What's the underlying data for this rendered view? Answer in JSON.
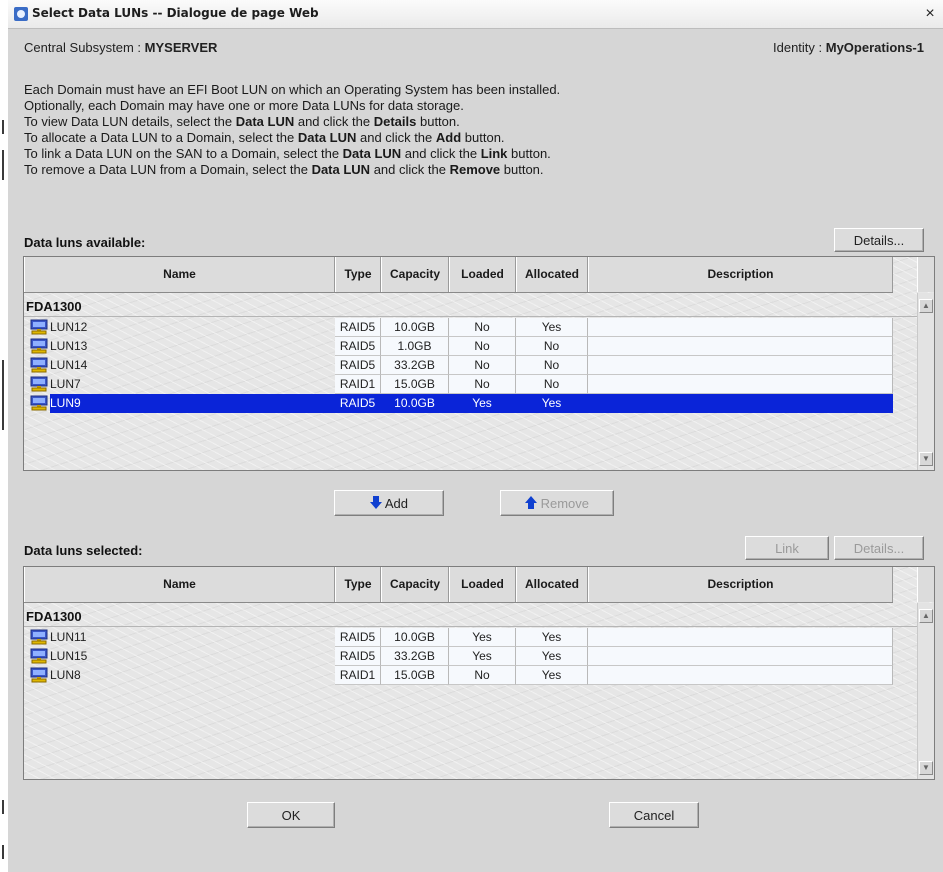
{
  "window": {
    "title": "Select Data LUNs -- Dialogue de page Web",
    "close": "×"
  },
  "header": {
    "subsystem_label": "Central Subsystem : ",
    "subsystem_value": "MYSERVER",
    "identity_label": "Identity : ",
    "identity_value": "MyOperations-1"
  },
  "instructions": [
    {
      "parts": [
        "Each Domain must have an EFI Boot LUN on which an Operating System has been installed."
      ]
    },
    {
      "parts": [
        "Optionally, each Domain may have one or more Data LUNs for data storage."
      ]
    },
    {
      "parts": [
        "To view Data LUN details, select the ",
        "Data LUN",
        " and click the ",
        "Details",
        " button."
      ]
    },
    {
      "parts": [
        "To allocate a Data LUN to a Domain, select the ",
        "Data LUN",
        " and click the ",
        "Add",
        " button."
      ]
    },
    {
      "parts": [
        "To link a Data LUN on the SAN to a Domain, select the ",
        "Data LUN",
        " and click the ",
        "Link",
        " button."
      ]
    },
    {
      "parts": [
        "To remove a Data LUN from a Domain, select the ",
        "Data LUN",
        " and click the ",
        "Remove",
        " button."
      ]
    }
  ],
  "available": {
    "title": "Data luns available:",
    "details_label": "Details...",
    "columns": [
      "Name",
      "Type",
      "Capacity",
      "Loaded",
      "Allocated",
      "Description"
    ],
    "group": "FDA1300",
    "selected_index": 4,
    "rows": [
      {
        "name": "LUN12",
        "type": "RAID5",
        "capacity": "10.0GB",
        "loaded": "No",
        "allocated": "Yes",
        "description": ""
      },
      {
        "name": "LUN13",
        "type": "RAID5",
        "capacity": "1.0GB",
        "loaded": "No",
        "allocated": "No",
        "description": ""
      },
      {
        "name": "LUN14",
        "type": "RAID5",
        "capacity": "33.2GB",
        "loaded": "No",
        "allocated": "No",
        "description": ""
      },
      {
        "name": "LUN7",
        "type": "RAID1",
        "capacity": "15.0GB",
        "loaded": "No",
        "allocated": "No",
        "description": ""
      },
      {
        "name": "LUN9",
        "type": "RAID5",
        "capacity": "10.0GB",
        "loaded": "Yes",
        "allocated": "Yes",
        "description": ""
      }
    ]
  },
  "actions": {
    "add_label": "Add",
    "remove_label": "Remove"
  },
  "selected": {
    "title": "Data luns selected:",
    "link_label": "Link",
    "details_label": "Details...",
    "columns": [
      "Name",
      "Type",
      "Capacity",
      "Loaded",
      "Allocated",
      "Description"
    ],
    "group": "FDA1300",
    "rows": [
      {
        "name": "LUN11",
        "type": "RAID5",
        "capacity": "10.0GB",
        "loaded": "Yes",
        "allocated": "Yes",
        "description": ""
      },
      {
        "name": "LUN15",
        "type": "RAID5",
        "capacity": "33.2GB",
        "loaded": "Yes",
        "allocated": "Yes",
        "description": ""
      },
      {
        "name": "LUN8",
        "type": "RAID1",
        "capacity": "15.0GB",
        "loaded": "No",
        "allocated": "Yes",
        "description": ""
      }
    ]
  },
  "footer": {
    "ok_label": "OK",
    "cancel_label": "Cancel"
  },
  "colors": {
    "selection": "#0a24d8",
    "dialog_bg": "#d6d6d6"
  },
  "icons": {
    "row_icon": "storage-lun-icon",
    "add_icon": "arrow-down-icon",
    "remove_icon": "arrow-up-icon"
  }
}
